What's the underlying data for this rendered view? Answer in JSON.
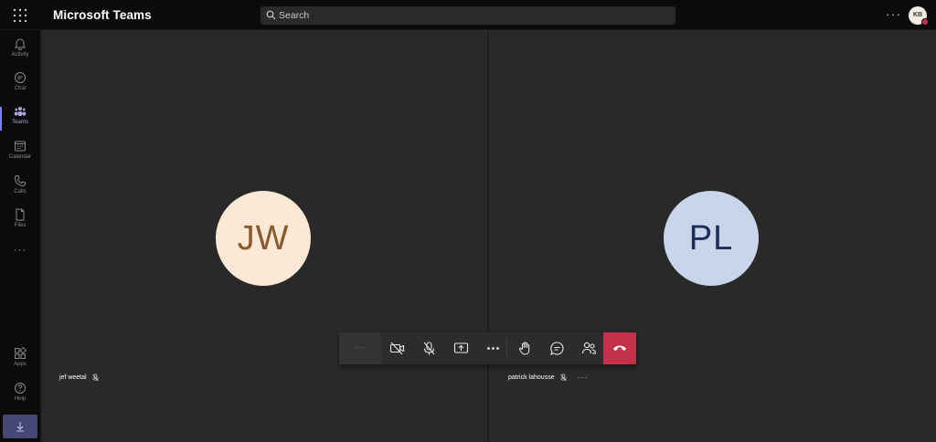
{
  "app": {
    "title": "Microsoft Teams"
  },
  "search": {
    "placeholder": "Search"
  },
  "user": {
    "initials": "KB",
    "presence_color": "#c4314b"
  },
  "rail": {
    "items": [
      {
        "label": "Activity",
        "icon": "bell-icon"
      },
      {
        "label": "Chat",
        "icon": "chat-icon"
      },
      {
        "label": "Teams",
        "icon": "teams-icon",
        "active": true
      },
      {
        "label": "Calendar",
        "icon": "calendar-icon"
      },
      {
        "label": "Calls",
        "icon": "phone-icon"
      },
      {
        "label": "Files",
        "icon": "file-icon"
      }
    ],
    "more": "···",
    "bottom": [
      {
        "label": "Apps",
        "icon": "apps-icon"
      },
      {
        "label": "Help",
        "icon": "help-icon"
      }
    ]
  },
  "participants": [
    {
      "initials": "JW",
      "name": "jef weetal",
      "muted": true,
      "avatar_bg": "#fbe8d7",
      "avatar_fg": "#8a5a2b"
    },
    {
      "initials": "PL",
      "name": "patrick lahousse",
      "muted": true,
      "avatar_bg": "#c8d5ea",
      "avatar_fg": "#1c2e57"
    }
  ],
  "call_controls": {
    "timer": "--:--",
    "buttons": [
      "camera-off-icon",
      "mic-off-icon",
      "share-screen-icon",
      "more-icon",
      "raise-hand-icon",
      "chat-icon",
      "participants-icon",
      "hang-up-icon"
    ],
    "hangup_color": "#c4314b"
  },
  "accent": "#7b83eb"
}
